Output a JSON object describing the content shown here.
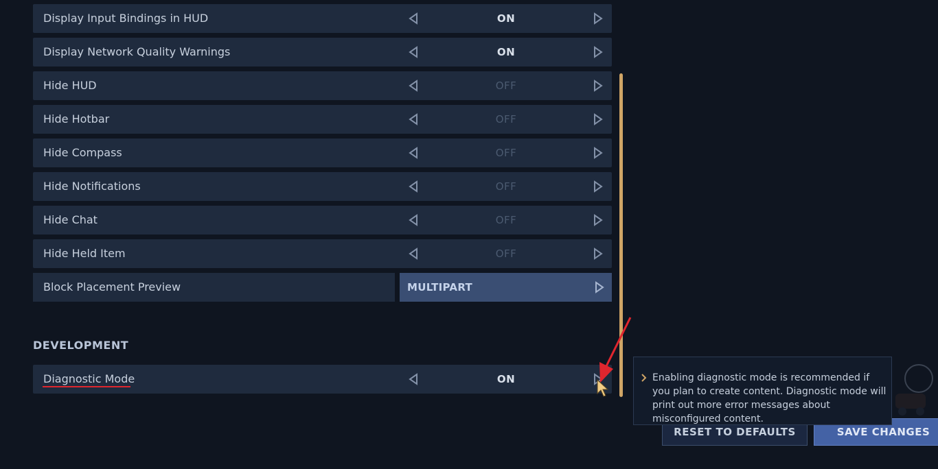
{
  "settings": [
    {
      "label": "Display Input Bindings in HUD",
      "value": "ON",
      "state": "on"
    },
    {
      "label": "Display Network Quality Warnings",
      "value": "ON",
      "state": "on"
    },
    {
      "label": "Hide HUD",
      "value": "OFF",
      "state": "off"
    },
    {
      "label": "Hide Hotbar",
      "value": "OFF",
      "state": "off"
    },
    {
      "label": "Hide Compass",
      "value": "OFF",
      "state": "off"
    },
    {
      "label": "Hide Notifications",
      "value": "OFF",
      "state": "off"
    },
    {
      "label": "Hide Chat",
      "value": "OFF",
      "state": "off"
    },
    {
      "label": "Hide Held Item",
      "value": "OFF",
      "state": "off"
    }
  ],
  "block_placement": {
    "label": "Block Placement Preview",
    "value": "MULTIPART"
  },
  "development": {
    "section_title": "DEVELOPMENT",
    "diagnostic": {
      "label": "Diagnostic Mode",
      "value": "ON"
    }
  },
  "tooltip": {
    "text": "Enabling diagnostic mode is recommended if you plan to create content. Diagnostic mode will print out more error messages about misconfigured content."
  },
  "buttons": {
    "reset": "RESET TO DEFAULTS",
    "save": "SAVE CHANGES"
  },
  "colors": {
    "accent_scroll": "#d0a566",
    "annotation": "#e0262e",
    "save_button": "#4462a5"
  }
}
